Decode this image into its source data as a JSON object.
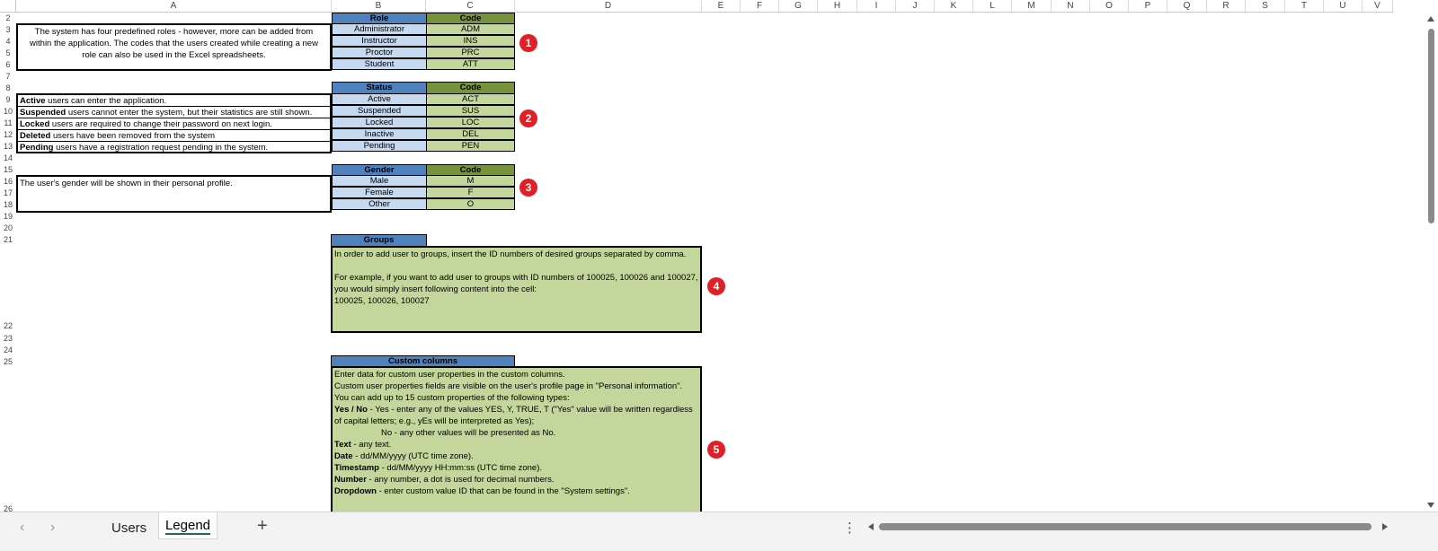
{
  "columns": [
    "A",
    "B",
    "C",
    "D",
    "E",
    "F",
    "G",
    "H",
    "I",
    "J",
    "K",
    "L",
    "M",
    "N",
    "O",
    "P",
    "Q",
    "R",
    "S",
    "T",
    "U",
    "V"
  ],
  "rows": [
    "2",
    "3",
    "4",
    "5",
    "6",
    "7",
    "8",
    "9",
    "10",
    "11",
    "12",
    "13",
    "14",
    "15",
    "16",
    "17",
    "18",
    "19",
    "20",
    "21",
    "22",
    "23",
    "24",
    "25",
    "26"
  ],
  "role_table": {
    "header_left": "Role",
    "header_right": "Code",
    "rows": [
      [
        "Administrator",
        "ADM"
      ],
      [
        "Instructor",
        "INS"
      ],
      [
        "Proctor",
        "PRC"
      ],
      [
        "Student",
        "ATT"
      ]
    ],
    "description": [
      "The system has four predefined roles - however, more can be added from",
      "within the application. The codes that the users created while creating a new",
      "role can also be used in the Excel spreadsheets."
    ]
  },
  "status_table": {
    "header_left": "Status",
    "header_right": "Code",
    "rows": [
      [
        "Active",
        "ACT"
      ],
      [
        "Suspended",
        "SUS"
      ],
      [
        "Locked",
        "LOC"
      ],
      [
        "Inactive",
        "DEL"
      ],
      [
        "Pending",
        "PEN"
      ]
    ],
    "descriptions": [
      {
        "bold": "Active",
        "rest": " users can enter the application."
      },
      {
        "bold": "Suspended",
        "rest": " users cannot enter the system, but their statistics are still shown."
      },
      {
        "bold": "Locked",
        "rest": " users are required to change their password on next login."
      },
      {
        "bold": "Deleted",
        "rest": " users have been removed from the system"
      },
      {
        "bold": "Pending",
        "rest": " users have a registration request pending in the system."
      }
    ]
  },
  "gender_table": {
    "header_left": "Gender",
    "header_right": "Code",
    "rows": [
      [
        "Male",
        "M"
      ],
      [
        "Female",
        "F"
      ],
      [
        "Other",
        "O"
      ]
    ],
    "description": "The user's gender will be shown in their personal profile."
  },
  "groups": {
    "header": "Groups",
    "lines": [
      "In order to add user to groups, insert the ID numbers of desired groups separated by comma.",
      "For example, if you want to add user to groups with ID numbers of 100025, 100026 and 100027, you would simply insert following content into the cell:",
      "100025, 100026, 100027"
    ]
  },
  "custom_columns": {
    "header": "Custom columns",
    "l1": "Enter data for custom user properties in the custom columns.",
    "l2": "Custom user properties fields are visible on the user's profile page in \"Personal information\".",
    "l3": "You can add up to 15 custom properties of the following types:",
    "yesno_b": "Yes / No",
    "yesno_t": " - Yes - enter any of the values YES, Y, TRUE, T (\"Yes\" value will be written regardless of capital letters; e.g., yEs will be interpreted as Yes);",
    "yesno_no": "No - any other values will be presented as No.",
    "text_b": "Text",
    "text_t": " - any text.",
    "date_b": "Date",
    "date_t": " - dd/MM/yyyy  (UTC time zone).",
    "ts_b": "Timestamp",
    "ts_t": " -  dd/MM/yyyy HH:mm:ss (UTC time zone).",
    "num_b": "Number",
    "num_t": " - any number, a dot is used for decimal numbers.",
    "dd_b": "Dropdown",
    "dd_t": " - enter custom value ID that can be found in the \"System settings\"."
  },
  "badges": [
    "1",
    "2",
    "3",
    "4",
    "5"
  ],
  "sheet_tabs": {
    "tab1": "Users",
    "tab2": "Legend",
    "add": "+",
    "more": "⋮"
  },
  "colors": {
    "header_blue": "#4f81bd",
    "header_green": "#76923c",
    "light_blue": "#c5d9f1",
    "light_green": "#c3d69b",
    "badge_red": "#e21f26"
  }
}
